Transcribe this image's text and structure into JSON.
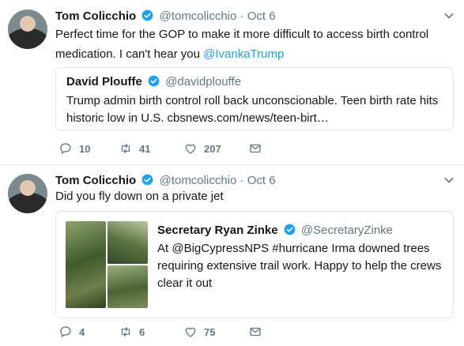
{
  "tweets": [
    {
      "name": "Tom Colicchio",
      "handle": "@tomcolicchio",
      "separator": "·",
      "date": "Oct 6",
      "text_plain": "Perfect time for the GOP to make it more difficult to access birth control medication. I can't hear you ",
      "text_mention": "@IvankaTrump",
      "quote": {
        "name": "David Plouffe",
        "handle": "@davidplouffe",
        "text": "Trump admin birth control roll back unconscionable. Teen birth rate hits historic low in U.S. cbsnews.com/news/teen-birt…"
      },
      "replies": "10",
      "retweets": "41",
      "likes": "207"
    },
    {
      "name": "Tom Colicchio",
      "handle": "@tomcolicchio",
      "separator": "·",
      "date": "Oct 6",
      "text_plain": "Did you fly down on a private jet",
      "quote": {
        "name": "Secretary Ryan Zinke",
        "handle": "@SecretaryZinke",
        "text": "At @BigCypressNPS #hurricane Irma downed trees requiring extensive trail work. Happy to help the crews clear it out"
      },
      "replies": "4",
      "retweets": "6",
      "likes": "75"
    }
  ],
  "colors": {
    "accent": "#1da1f2",
    "muted": "#657786",
    "text": "#14171a",
    "border": "#e1e8ed"
  },
  "icons": [
    "verified-badge-icon",
    "caret-down-icon",
    "reply-icon",
    "retweet-icon",
    "like-icon",
    "direct-message-icon"
  ]
}
